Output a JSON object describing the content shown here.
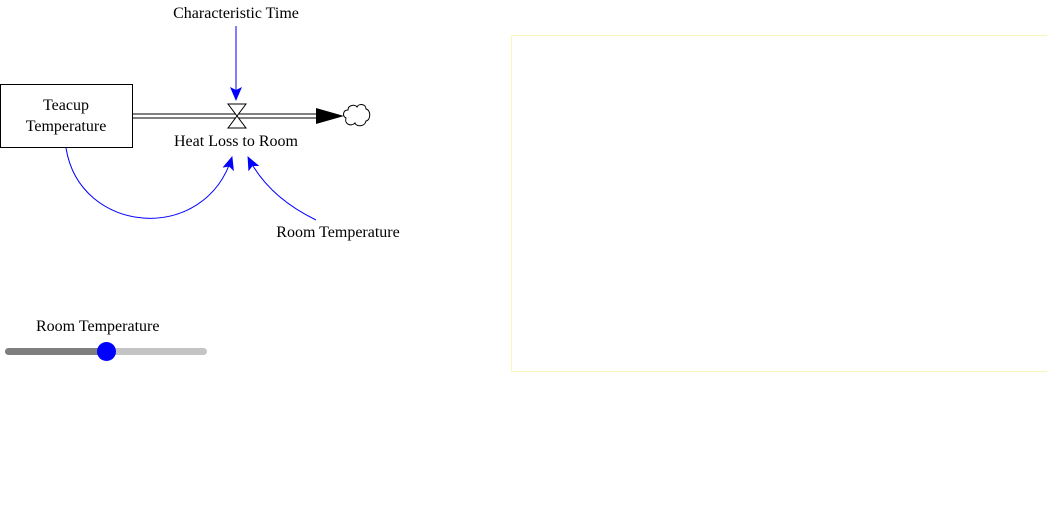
{
  "diagram": {
    "stock": {
      "label_line1": "Teacup",
      "label_line2": "Temperature"
    },
    "flow": {
      "label": "Heat Loss to Room"
    },
    "aux_characteristic_time": {
      "label": "Characteristic Time"
    },
    "aux_room_temperature": {
      "label": "Room Temperature"
    },
    "colors": {
      "link": "#0000ff",
      "pipe": "#000000",
      "stock_border": "#000000"
    }
  },
  "slider": {
    "label": "Room Temperature",
    "fraction": 0.5,
    "colors": {
      "track": "#c4c4c4",
      "fill": "#7f7f7f",
      "thumb": "#0000ff"
    }
  },
  "graph_panel": {
    "border_color": "#fbf7b5"
  }
}
